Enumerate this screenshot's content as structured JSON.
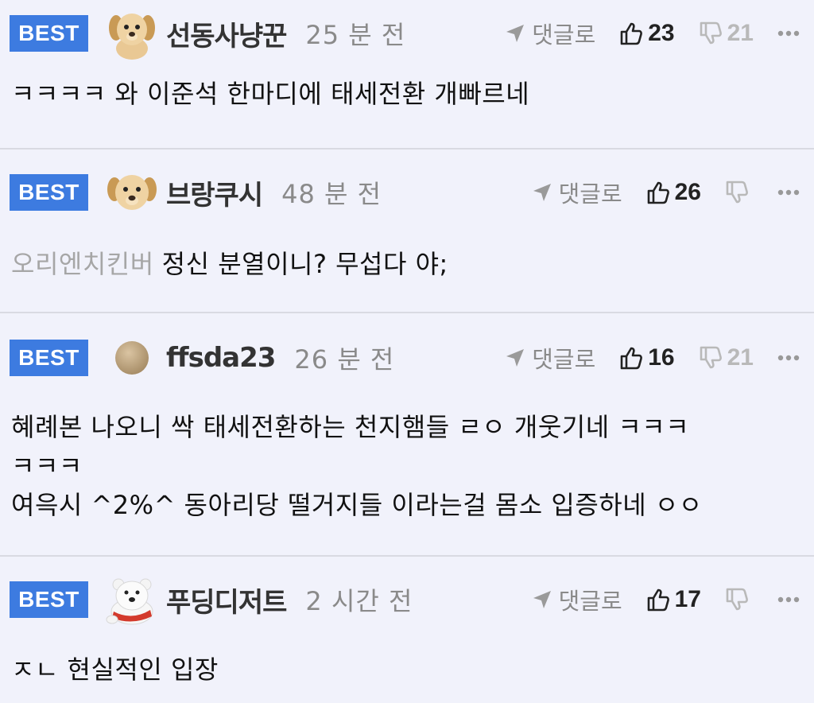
{
  "comments": [
    {
      "badge": "BEST",
      "avatar": "puppy-icon",
      "nick": "선동사냥꾼",
      "time": "25 분 전",
      "reply_label": "댓글로",
      "likes": "23",
      "dislikes": "21",
      "mention": "",
      "lines": [
        "ㅋㅋㅋㅋ 와 이준석 한마디에 태세전환 개빠르네"
      ]
    },
    {
      "badge": "BEST",
      "avatar": "puppy-icon",
      "nick": "브랑쿠시",
      "time": "48 분 전",
      "reply_label": "댓글로",
      "likes": "26",
      "dislikes": "",
      "mention": "오리엔치킨버",
      "lines": [
        "정신 분열이니? 무섭다 야;"
      ]
    },
    {
      "badge": "BEST",
      "avatar": "plain-circle-avatar",
      "nick": "ffsda23",
      "time": "26 분 전",
      "reply_label": "댓글로",
      "likes": "16",
      "dislikes": "21",
      "mention": "",
      "lines": [
        "혜례본 나오니 싹 태세전환하는 천지햄들 ㄹㅇ 개웃기네 ㅋㅋㅋ",
        "ㅋㅋㅋ",
        "여윽시 ^2%^ 동아리당 떨거지들 이라는걸 몸소 입증하네 ㅇㅇ"
      ]
    },
    {
      "badge": "BEST",
      "avatar": "polar-bear-icon",
      "nick": "푸딩디저트",
      "time": "2 시간 전",
      "reply_label": "댓글로",
      "likes": "17",
      "dislikes": "",
      "mention": "",
      "lines": [
        "ㅈㄴ 현실적인 입장"
      ]
    }
  ],
  "colors": {
    "badge_bg": "#3d7be0",
    "background": "#f1f2fb",
    "meta_gray": "#8a8a8a",
    "dislike_gray": "#b9b9b9"
  }
}
